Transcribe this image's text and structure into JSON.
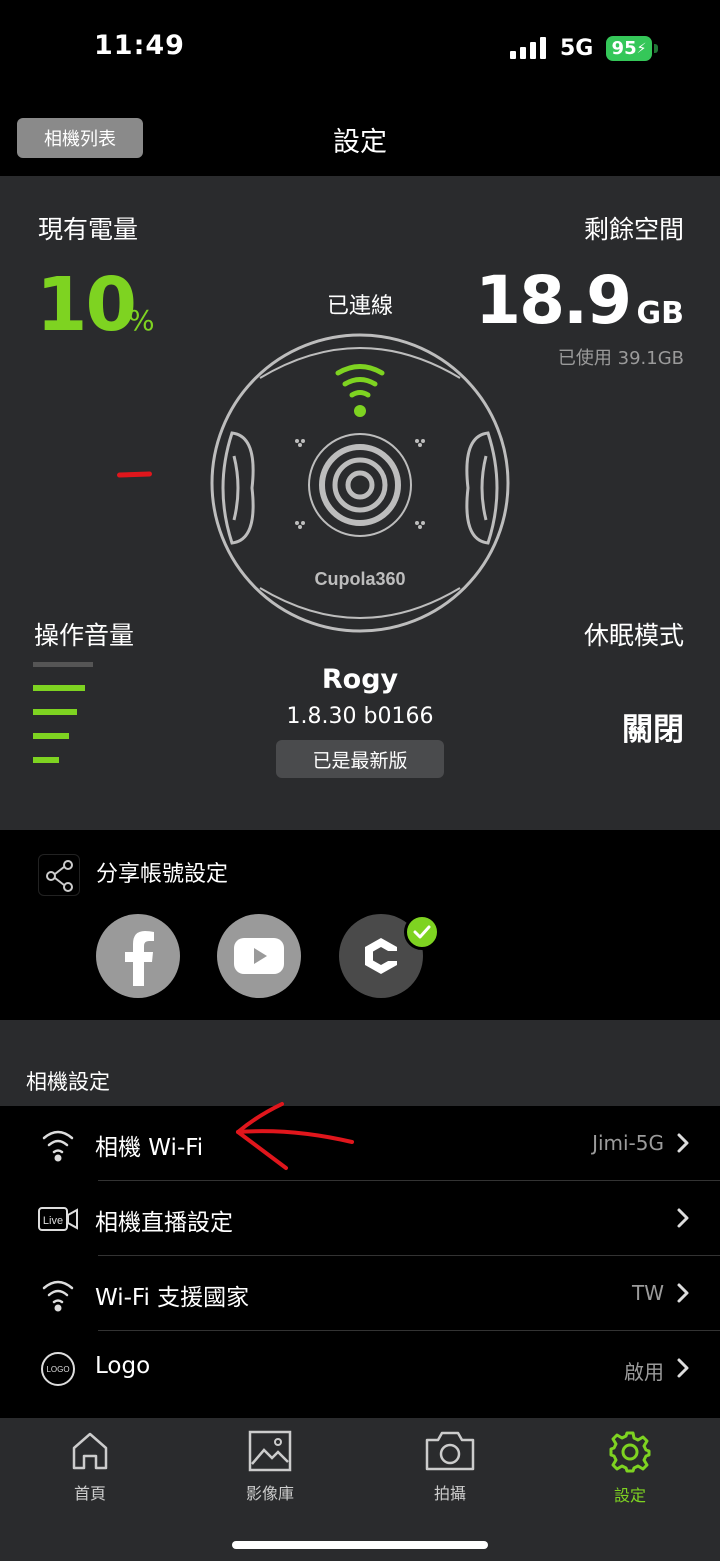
{
  "status": {
    "time": "11:49",
    "network": "5G",
    "battery": "95"
  },
  "nav": {
    "camera_list": "相機列表",
    "title": "設定"
  },
  "camera_panel": {
    "battery_label": "現有電量",
    "battery_value": "10",
    "battery_unit": "%",
    "space_label": "剩餘空間",
    "space_value": "18.9",
    "space_unit": "GB",
    "space_used": "已使用 39.1GB",
    "connection": "已連線",
    "camera_brand": "Cupola360",
    "volume_label": "操作音量",
    "volume_level": 3,
    "volume_max": 4,
    "sleep_label": "休眠模式",
    "sleep_value": "關閉",
    "camera_name": "Rogy",
    "firmware_version": "1.8.30 b0166",
    "firmware_status": "已是最新版"
  },
  "share": {
    "title": "分享帳號設定",
    "accounts": [
      "facebook",
      "youtube",
      "cupola360"
    ]
  },
  "section": {
    "title": "相機設定"
  },
  "settings": [
    {
      "icon": "wifi-icon",
      "label": "相機 Wi-Fi",
      "value": "Jimi-5G"
    },
    {
      "icon": "live-icon",
      "label": "相機直播設定",
      "value": ""
    },
    {
      "icon": "wifi-icon",
      "label": "Wi-Fi 支援國家",
      "value": "TW"
    },
    {
      "icon": "logo-icon",
      "label": "Logo",
      "value": "啟用"
    }
  ],
  "tabs": [
    {
      "label": "首頁",
      "icon": "home-icon"
    },
    {
      "label": "影像庫",
      "icon": "gallery-icon"
    },
    {
      "label": "拍攝",
      "icon": "camera-icon"
    },
    {
      "label": "設定",
      "icon": "gear-icon",
      "active": true
    }
  ],
  "colors": {
    "accent": "#7ed321",
    "panel": "#2a2b2d",
    "background": "#000000"
  }
}
